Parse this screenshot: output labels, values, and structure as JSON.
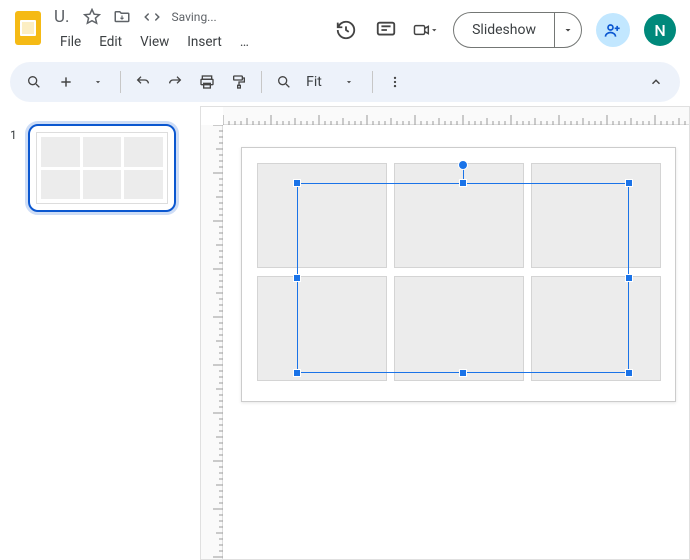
{
  "header": {
    "doc_title": "U.",
    "saving_status": "Saving...",
    "menus": [
      "File",
      "Edit",
      "View",
      "Insert",
      "…"
    ],
    "slideshow_label": "Slideshow",
    "avatar_initial": "N"
  },
  "toolbar": {
    "zoom_label": "Fit"
  },
  "sidebar": {
    "slides": [
      {
        "number": "1"
      }
    ]
  }
}
